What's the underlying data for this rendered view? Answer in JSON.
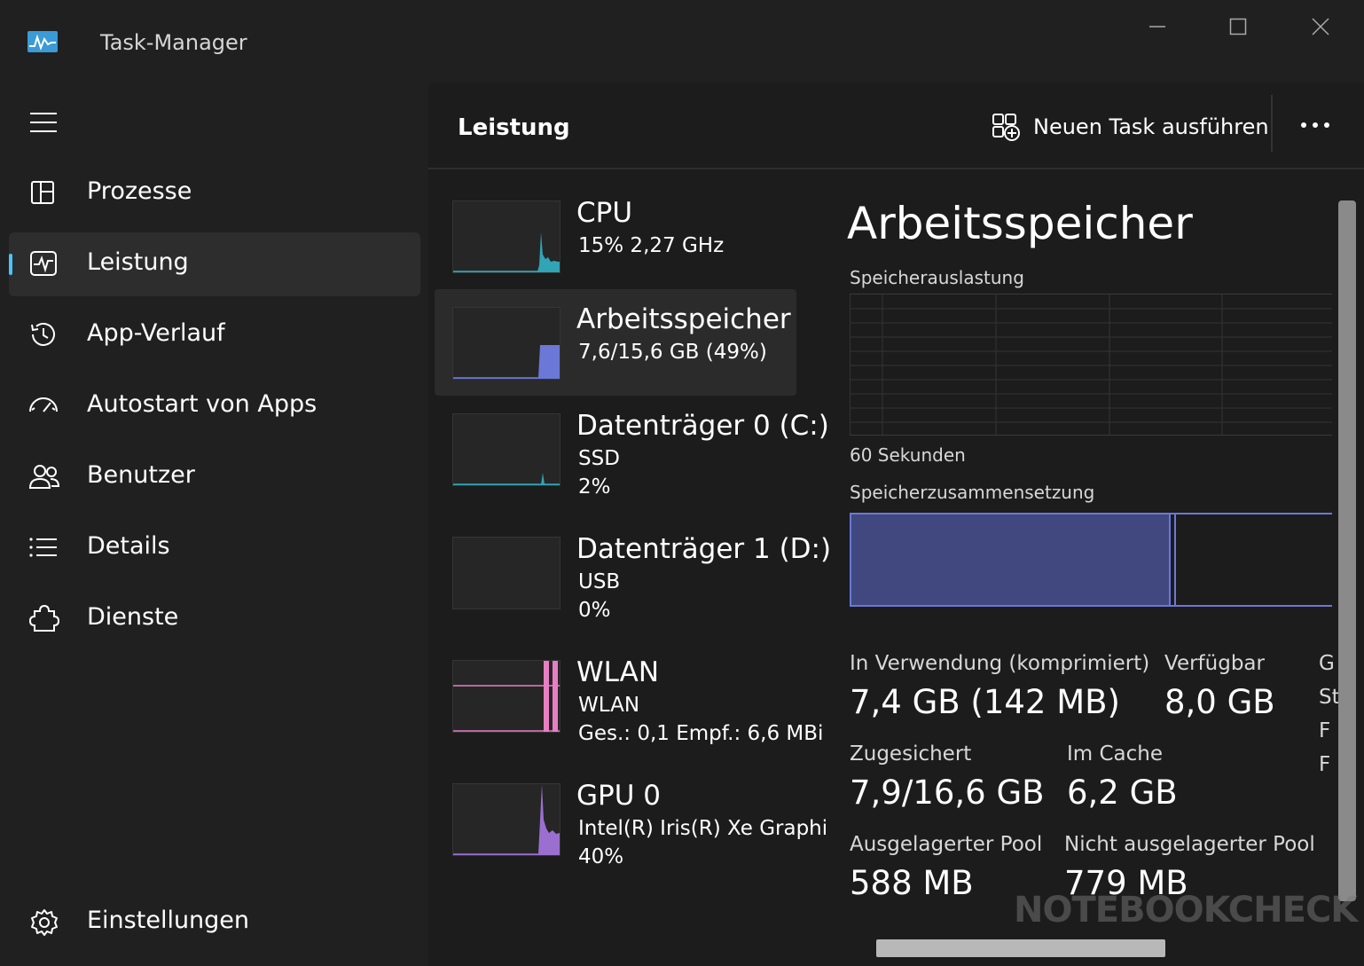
{
  "window": {
    "title": "Task-Manager",
    "app_icon": "task-manager-icon",
    "controls": [
      "minimize-icon",
      "maximize-icon",
      "close-icon"
    ]
  },
  "sidebar": {
    "menu_icon": "hamburger-icon",
    "items": [
      {
        "label": "Prozesse",
        "icon": "processes-icon",
        "active": false
      },
      {
        "label": "Leistung",
        "icon": "performance-icon",
        "active": true
      },
      {
        "label": "App-Verlauf",
        "icon": "history-icon",
        "active": false
      },
      {
        "label": "Autostart von Apps",
        "icon": "speedometer-icon",
        "active": false
      },
      {
        "label": "Benutzer",
        "icon": "users-icon",
        "active": false
      },
      {
        "label": "Details",
        "icon": "list-icon",
        "active": false
      },
      {
        "label": "Dienste",
        "icon": "puzzle-icon",
        "active": false
      }
    ],
    "settings_label": "Einstellungen",
    "settings_icon": "gear-icon"
  },
  "header": {
    "title": "Leistung",
    "new_task_label": "Neuen Task ausführen",
    "new_task_icon": "new-task-icon",
    "more_icon": "more-icon"
  },
  "devices": [
    {
      "name": "CPU",
      "line1": "15%  2,27 GHz",
      "line2": "",
      "color": "#2fa5b5",
      "active": false
    },
    {
      "name": "Arbeitsspeicher",
      "line1": "7,6/15,6 GB (49%)",
      "line2": "",
      "color": "#6b78d8",
      "active": true
    },
    {
      "name": "Datenträger 0 (C:)",
      "line1": "SSD",
      "line2": "2%",
      "color": "#2fa5b5",
      "active": false
    },
    {
      "name": "Datenträger 1 (D:)",
      "line1": "USB",
      "line2": "0%",
      "color": "#2fa5b5",
      "active": false
    },
    {
      "name": "WLAN",
      "line1": "WLAN",
      "line2": "Ges.: 0,1  Empf.: 6,6 MBi",
      "color": "#e77fc4",
      "active": false
    },
    {
      "name": "GPU 0",
      "line1": "Intel(R) Iris(R) Xe Graphi",
      "line2": "40%",
      "color": "#9b6fd0",
      "active": false
    }
  ],
  "detail": {
    "title": "Arbeitsspeicher",
    "usage_label": "Speicherauslastung",
    "time_label": "60 Sekunden",
    "composition_label": "Speicherzusammensetzung",
    "composition_in_use_fraction": 0.66,
    "stats": [
      {
        "label": "In Verwendung (komprimiert)",
        "value": "7,4 GB (142 MB)"
      },
      {
        "label": "Verfügbar",
        "value": "8,0 GB"
      },
      {
        "label": "Zugesichert",
        "value": "7,9/16,6 GB"
      },
      {
        "label": "Im Cache",
        "value": "6,2 GB"
      },
      {
        "label": "Ausgelagerter Pool",
        "value": "588 MB"
      },
      {
        "label": "Nicht ausgelagerter Pool",
        "value": "779 MB"
      }
    ],
    "cut_off_labels": [
      "G",
      "St",
      "F",
      "F"
    ]
  },
  "watermark": "NOTEBOOKCHECK",
  "colors": {
    "background": "#202020",
    "panel": "#1c1c1c",
    "accent": "#4cc2ff",
    "memory": "#6b78d8"
  }
}
